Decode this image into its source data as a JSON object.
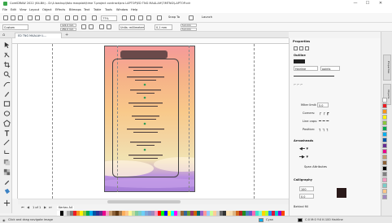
{
  "window": {
    "title": "CorelDRAW 2022 (64-Bit) - D:\\A backup\\foto maqalah\\time T-project contract\\aro LAPTOP\\ED TNG MAALAH\\TIMTNG\\LAPTOP.cdr",
    "minimize": "—",
    "maximize": "☐",
    "close": "✕"
  },
  "menu": [
    "File",
    "Edit",
    "View",
    "Layout",
    "Object",
    "Effects",
    "Bitmaps",
    "Text",
    "Table",
    "Tools",
    "Window",
    "Help"
  ],
  "toolbar": {
    "zoom": "77%",
    "snap_to": "Snap To",
    "launch": "Launch"
  },
  "propertybar": {
    "paper": "Custom",
    "width": "122,0 mm",
    "height": "250,0 mm",
    "units": "Units: millimeters",
    "nudge": "0,1 mm",
    "dup_x": "5,0 mm",
    "dup_y": "5,0 mm"
  },
  "document_tab": "ED TNG MAALAH L...",
  "page_nav": {
    "counter": "1 of 1",
    "page_label": "Kertas A4"
  },
  "status": {
    "hint": "Click and drag navigate image",
    "fill": "Cyan",
    "color_info": "C:0 M:0 Y:0 K:100 Hairline"
  },
  "dock": {
    "title": "Properties",
    "section_outline": "Outline",
    "outline_width": "Hairline",
    "outline_units": "points",
    "miter_label": "Miter limit:",
    "miter_value": "5,0",
    "corners_label": "Corners:",
    "line_caps_label": "Line caps:",
    "position_label": "Position:",
    "arrowheads_label": "Arrowheads",
    "span_attributes": "Span Attributes",
    "calligraphy_label": "Calligraphy",
    "stretch_value": "100",
    "angle_value": "0,0",
    "behind_fill": "Behind fill"
  },
  "sidebar_tabs": [
    "Properties",
    "Objects"
  ],
  "colors": {
    "accent": "#1a6fd1",
    "logo": "#3aa84a",
    "poster_head": "#6a4a4a"
  }
}
